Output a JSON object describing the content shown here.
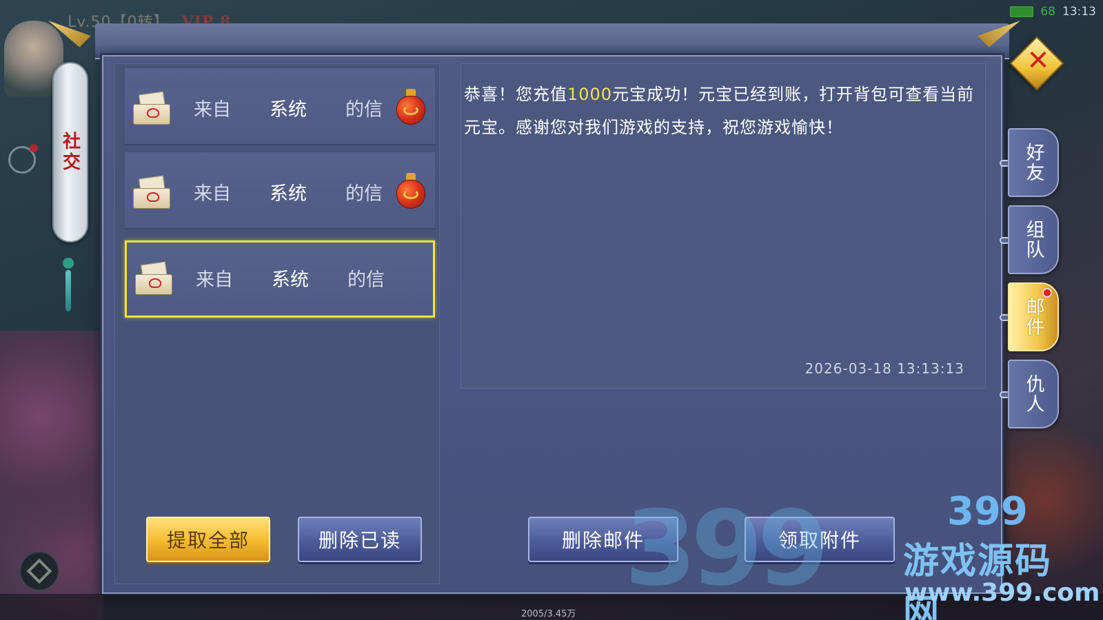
{
  "status_bar": {
    "battery": "68",
    "time": "13:13"
  },
  "player": {
    "level": "Lv.50【0转】",
    "vip": "VIP 8"
  },
  "side_scroll": {
    "label": "社交"
  },
  "mail_list": {
    "items": [
      {
        "from": "来自",
        "sender": "系统",
        "suffix": "的信",
        "has_attachment": true,
        "selected": false
      },
      {
        "from": "来自",
        "sender": "系统",
        "suffix": "的信",
        "has_attachment": true,
        "selected": false
      },
      {
        "from": "来自",
        "sender": "系统",
        "suffix": "的信",
        "has_attachment": false,
        "selected": true
      }
    ]
  },
  "buttons": {
    "claim_all": "提取全部",
    "delete_read": "删除已读",
    "delete_mail": "删除邮件",
    "claim_attachment": "领取附件"
  },
  "mail_content": {
    "body_part1": "恭喜！您充值",
    "amount": "1000",
    "body_part2": "元宝成功！元宝已经到账，打开背包可查看当前元宝。感谢您对我们游戏的支持，祝您游戏愉快！",
    "timestamp": "2026-03-18  13:13:13"
  },
  "close": {
    "label": "✕"
  },
  "side_tabs": [
    {
      "label": "好友",
      "active": false,
      "notification": false
    },
    {
      "label": "组队",
      "active": false,
      "notification": false
    },
    {
      "label": "邮件",
      "active": true,
      "notification": true
    },
    {
      "label": "仇人",
      "active": false,
      "notification": false
    }
  ],
  "bottom": {
    "stat": "2005/3.45万"
  },
  "watermark": {
    "logo": "399",
    "number": "399",
    "text": "游戏源码网",
    "url": "www.399.com"
  },
  "colors": {
    "accent_gold": "#f5bb2d",
    "selection": "#f3e533",
    "amount_highlight": "#f4e25a",
    "panel": "#4a5681"
  }
}
